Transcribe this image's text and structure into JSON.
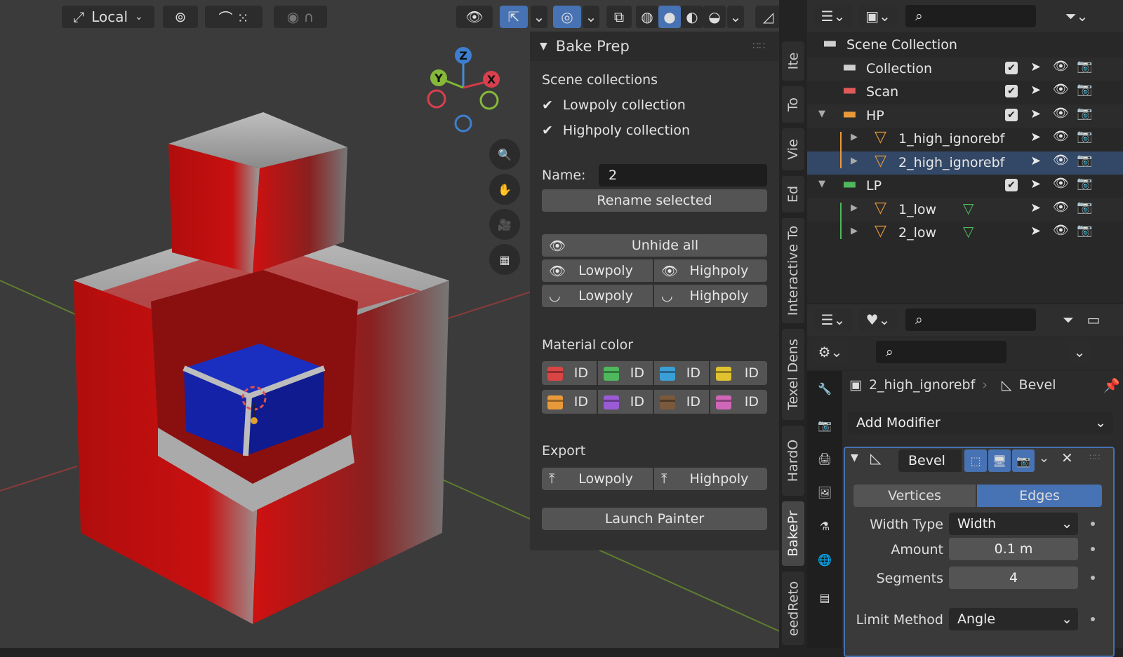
{
  "toolbar": {
    "pivot_label": "Local"
  },
  "npanel": {
    "title": "Bake Prep",
    "scene_collections_label": "Scene collections",
    "lowpoly_collection": "Lowpoly collection",
    "highpoly_collection": "Highpoly collection",
    "name_label": "Name:",
    "name_value": "2",
    "rename_button": "Rename selected",
    "unhide_all": "Unhide all",
    "lowpoly": "Lowpoly",
    "highpoly": "Highpoly",
    "material_color_label": "Material color",
    "id_label": "ID",
    "id_colors": [
      "#d94545",
      "#4fb85c",
      "#3a9fd6",
      "#e0c230",
      "#e89a3a",
      "#9a5bd4",
      "#7a5a3c",
      "#d066b8"
    ],
    "export_label": "Export",
    "launch_painter": "Launch Painter"
  },
  "side_tabs": [
    "Ite",
    "To",
    "Vie",
    "Ed",
    "Interactive To",
    "Texel Dens",
    "HardO",
    "BakePr",
    "eedReto"
  ],
  "outliner": {
    "rows": [
      {
        "name": "Scene Collection"
      },
      {
        "name": "Collection"
      },
      {
        "name": "Scan"
      },
      {
        "name": "HP"
      },
      {
        "name": "1_high_ignorebf"
      },
      {
        "name": "2_high_ignorebf"
      },
      {
        "name": "LP"
      },
      {
        "name": "1_low"
      },
      {
        "name": "2_low"
      }
    ]
  },
  "properties": {
    "object_name": "2_high_ignorebf",
    "modifier_name": "Bevel",
    "add_modifier": "Add Modifier",
    "mod_name_field": "Bevel",
    "vertices_tab": "Vertices",
    "edges_tab": "Edges",
    "width_type_label": "Width Type",
    "width_type_value": "Width",
    "amount_label": "Amount",
    "amount_value": "0.1 m",
    "segments_label": "Segments",
    "segments_value": "4",
    "limit_method_label": "Limit Method",
    "limit_method_value": "Angle"
  },
  "colors": {
    "accent": "#4772b3",
    "viewport_bg": "#3a3a3a",
    "panel_bg": "#303030"
  }
}
